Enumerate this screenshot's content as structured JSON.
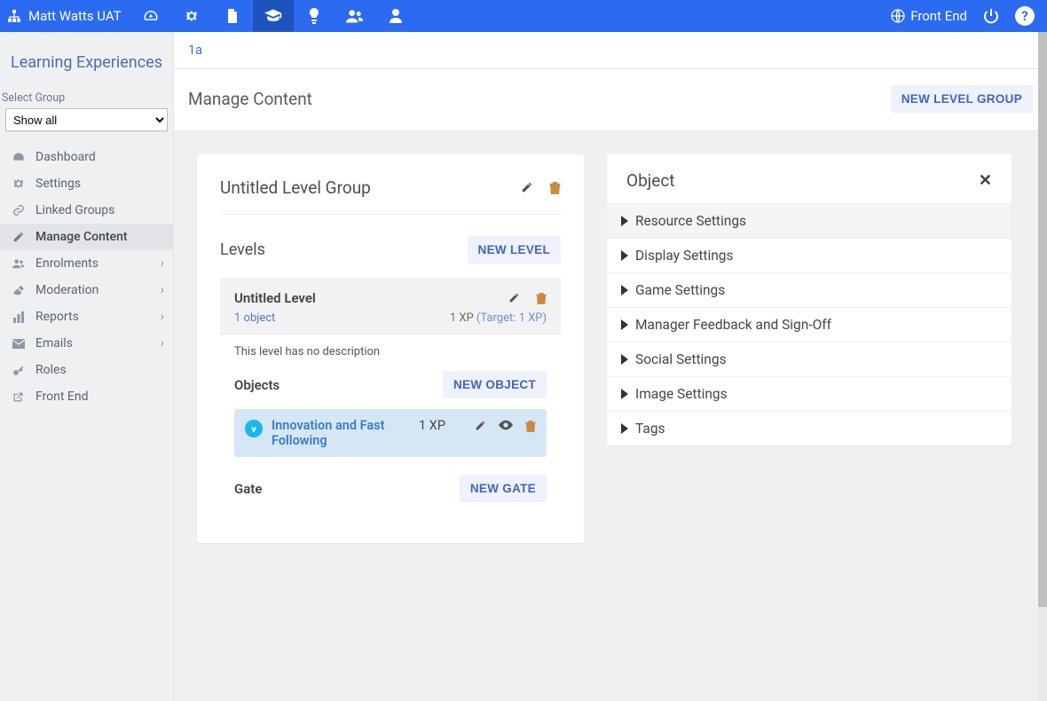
{
  "topbar": {
    "brand": "Matt Watts UAT",
    "front_end": "Front End"
  },
  "sidebar": {
    "title": "Learning Experiences",
    "select_label": "Select Group",
    "select_value": "Show all",
    "items": [
      {
        "label": "Dashboard"
      },
      {
        "label": "Settings"
      },
      {
        "label": "Linked Groups"
      },
      {
        "label": "Manage Content"
      },
      {
        "label": "Enrolments"
      },
      {
        "label": "Moderation"
      },
      {
        "label": "Reports"
      },
      {
        "label": "Emails"
      },
      {
        "label": "Roles"
      },
      {
        "label": "Front End"
      }
    ]
  },
  "crumb": "1a",
  "page": {
    "title": "Manage Content",
    "new_group_btn": "NEW LEVEL GROUP"
  },
  "group": {
    "title": "Untitled Level Group",
    "levels_label": "Levels",
    "new_level_btn": "NEW LEVEL",
    "level": {
      "title": "Untitled Level",
      "objects_link": "1 object",
      "xp": "1 XP ",
      "target": "(Target: 1 XP)",
      "no_desc": "This level has no description",
      "objects_label": "Objects",
      "new_object_btn": "NEW OBJECT",
      "object": {
        "title": "Innovation and Fast Following",
        "xp": "1 XP"
      },
      "gate_label": "Gate",
      "new_gate_btn": "NEW GATE"
    }
  },
  "panel": {
    "title": "Object",
    "items": [
      {
        "label": "Resource Settings"
      },
      {
        "label": "Display Settings"
      },
      {
        "label": "Game Settings"
      },
      {
        "label": "Manager Feedback and Sign-Off"
      },
      {
        "label": "Social Settings"
      },
      {
        "label": "Image Settings"
      },
      {
        "label": "Tags"
      }
    ]
  }
}
